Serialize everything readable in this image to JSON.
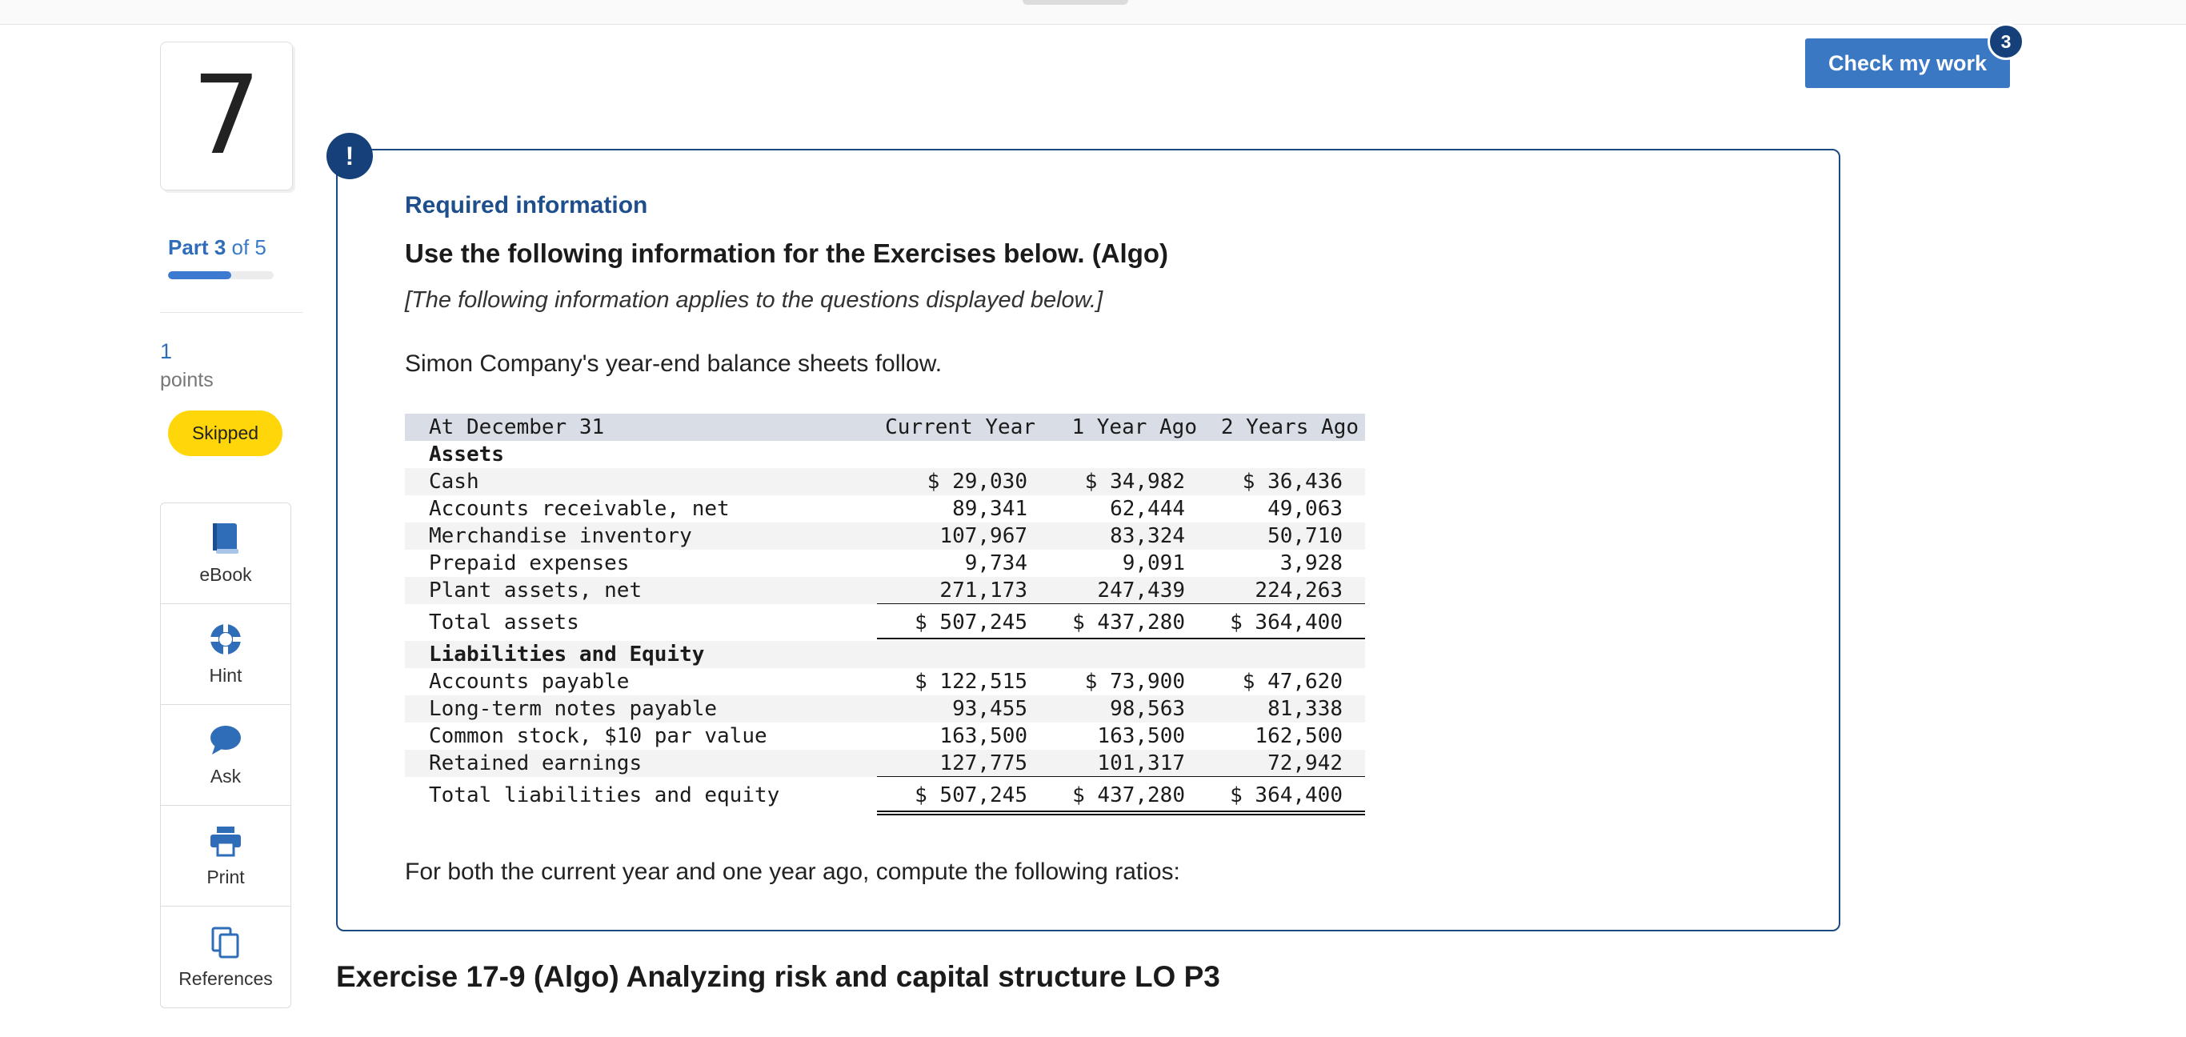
{
  "question": {
    "number": "7"
  },
  "part": {
    "label": "Part",
    "current": "3",
    "of_text": "of 5",
    "progress_percent": 60
  },
  "points": {
    "value": "1",
    "label": "points"
  },
  "status": {
    "badge": "Skipped",
    "badge_color": "#ffd60a"
  },
  "tools": [
    {
      "label": "eBook",
      "icon": "book-icon"
    },
    {
      "label": "Hint",
      "icon": "lifebuoy-icon"
    },
    {
      "label": "Ask",
      "icon": "chat-bubble-icon"
    },
    {
      "label": "Print",
      "icon": "printer-icon"
    },
    {
      "label": "References",
      "icon": "documents-icon"
    }
  ],
  "check": {
    "label": "Check my work",
    "badge": "3",
    "color": "#3a78c3"
  },
  "info": {
    "alert_symbol": "!",
    "required": "Required information",
    "title": "Use the following information for the Exercises below. (Algo)",
    "applies": "[The following information applies to the questions displayed below.]",
    "intro": "Simon Company's year-end balance sheets follow.",
    "closing": "For both the current year and one year ago, compute the following ratios:"
  },
  "balance_sheet": {
    "header": {
      "label": "At December 31",
      "col1": "Current Year",
      "col2": "1 Year Ago",
      "col3": "2 Years Ago"
    },
    "assets_heading": "Assets",
    "assets": [
      {
        "label": "Cash",
        "v1": "$ 29,030",
        "v2": "$ 34,982",
        "v3": "$ 36,436"
      },
      {
        "label": "Accounts receivable, net",
        "v1": "89,341",
        "v2": "62,444",
        "v3": "49,063"
      },
      {
        "label": "Merchandise inventory",
        "v1": "107,967",
        "v2": "83,324",
        "v3": "50,710"
      },
      {
        "label": "Prepaid expenses",
        "v1": "9,734",
        "v2": "9,091",
        "v3": "3,928"
      },
      {
        "label": "Plant assets, net",
        "v1": "271,173",
        "v2": "247,439",
        "v3": "224,263"
      }
    ],
    "total_assets": {
      "label": "Total assets",
      "v1": "$ 507,245",
      "v2": "$ 437,280",
      "v3": "$ 364,400"
    },
    "liab_heading": "Liabilities and Equity",
    "liabilities": [
      {
        "label": "Accounts payable",
        "v1": "$ 122,515",
        "v2": "$ 73,900",
        "v3": "$ 47,620"
      },
      {
        "label": "Long-term notes payable",
        "v1": "93,455",
        "v2": "98,563",
        "v3": "81,338"
      },
      {
        "label": "Common stock, $10 par value",
        "v1": "163,500",
        "v2": "163,500",
        "v3": "162,500"
      },
      {
        "label": "Retained earnings",
        "v1": "127,775",
        "v2": "101,317",
        "v3": "72,942"
      }
    ],
    "total_liab": {
      "label": "Total liabilities and equity",
      "v1": "$ 507,245",
      "v2": "$ 437,280",
      "v3": "$ 364,400"
    }
  },
  "exercise": {
    "title": "Exercise 17-9 (Algo) Analyzing risk and capital structure LO P3"
  }
}
